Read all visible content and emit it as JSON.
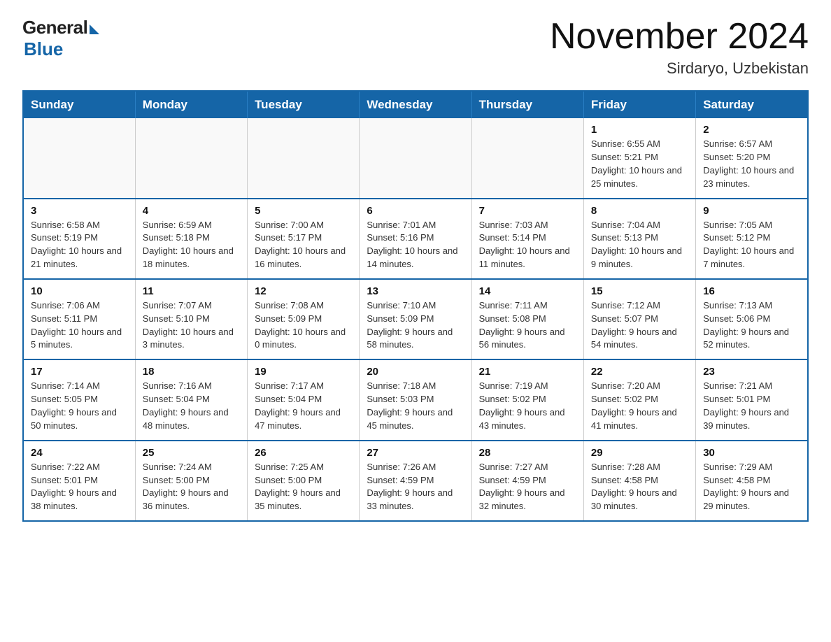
{
  "header": {
    "logo": {
      "general": "General",
      "blue": "Blue"
    },
    "title": "November 2024",
    "location": "Sirdaryo, Uzbekistan"
  },
  "calendar": {
    "days_of_week": [
      "Sunday",
      "Monday",
      "Tuesday",
      "Wednesday",
      "Thursday",
      "Friday",
      "Saturday"
    ],
    "weeks": [
      [
        {
          "day": "",
          "info": ""
        },
        {
          "day": "",
          "info": ""
        },
        {
          "day": "",
          "info": ""
        },
        {
          "day": "",
          "info": ""
        },
        {
          "day": "",
          "info": ""
        },
        {
          "day": "1",
          "info": "Sunrise: 6:55 AM\nSunset: 5:21 PM\nDaylight: 10 hours and 25 minutes."
        },
        {
          "day": "2",
          "info": "Sunrise: 6:57 AM\nSunset: 5:20 PM\nDaylight: 10 hours and 23 minutes."
        }
      ],
      [
        {
          "day": "3",
          "info": "Sunrise: 6:58 AM\nSunset: 5:19 PM\nDaylight: 10 hours and 21 minutes."
        },
        {
          "day": "4",
          "info": "Sunrise: 6:59 AM\nSunset: 5:18 PM\nDaylight: 10 hours and 18 minutes."
        },
        {
          "day": "5",
          "info": "Sunrise: 7:00 AM\nSunset: 5:17 PM\nDaylight: 10 hours and 16 minutes."
        },
        {
          "day": "6",
          "info": "Sunrise: 7:01 AM\nSunset: 5:16 PM\nDaylight: 10 hours and 14 minutes."
        },
        {
          "day": "7",
          "info": "Sunrise: 7:03 AM\nSunset: 5:14 PM\nDaylight: 10 hours and 11 minutes."
        },
        {
          "day": "8",
          "info": "Sunrise: 7:04 AM\nSunset: 5:13 PM\nDaylight: 10 hours and 9 minutes."
        },
        {
          "day": "9",
          "info": "Sunrise: 7:05 AM\nSunset: 5:12 PM\nDaylight: 10 hours and 7 minutes."
        }
      ],
      [
        {
          "day": "10",
          "info": "Sunrise: 7:06 AM\nSunset: 5:11 PM\nDaylight: 10 hours and 5 minutes."
        },
        {
          "day": "11",
          "info": "Sunrise: 7:07 AM\nSunset: 5:10 PM\nDaylight: 10 hours and 3 minutes."
        },
        {
          "day": "12",
          "info": "Sunrise: 7:08 AM\nSunset: 5:09 PM\nDaylight: 10 hours and 0 minutes."
        },
        {
          "day": "13",
          "info": "Sunrise: 7:10 AM\nSunset: 5:09 PM\nDaylight: 9 hours and 58 minutes."
        },
        {
          "day": "14",
          "info": "Sunrise: 7:11 AM\nSunset: 5:08 PM\nDaylight: 9 hours and 56 minutes."
        },
        {
          "day": "15",
          "info": "Sunrise: 7:12 AM\nSunset: 5:07 PM\nDaylight: 9 hours and 54 minutes."
        },
        {
          "day": "16",
          "info": "Sunrise: 7:13 AM\nSunset: 5:06 PM\nDaylight: 9 hours and 52 minutes."
        }
      ],
      [
        {
          "day": "17",
          "info": "Sunrise: 7:14 AM\nSunset: 5:05 PM\nDaylight: 9 hours and 50 minutes."
        },
        {
          "day": "18",
          "info": "Sunrise: 7:16 AM\nSunset: 5:04 PM\nDaylight: 9 hours and 48 minutes."
        },
        {
          "day": "19",
          "info": "Sunrise: 7:17 AM\nSunset: 5:04 PM\nDaylight: 9 hours and 47 minutes."
        },
        {
          "day": "20",
          "info": "Sunrise: 7:18 AM\nSunset: 5:03 PM\nDaylight: 9 hours and 45 minutes."
        },
        {
          "day": "21",
          "info": "Sunrise: 7:19 AM\nSunset: 5:02 PM\nDaylight: 9 hours and 43 minutes."
        },
        {
          "day": "22",
          "info": "Sunrise: 7:20 AM\nSunset: 5:02 PM\nDaylight: 9 hours and 41 minutes."
        },
        {
          "day": "23",
          "info": "Sunrise: 7:21 AM\nSunset: 5:01 PM\nDaylight: 9 hours and 39 minutes."
        }
      ],
      [
        {
          "day": "24",
          "info": "Sunrise: 7:22 AM\nSunset: 5:01 PM\nDaylight: 9 hours and 38 minutes."
        },
        {
          "day": "25",
          "info": "Sunrise: 7:24 AM\nSunset: 5:00 PM\nDaylight: 9 hours and 36 minutes."
        },
        {
          "day": "26",
          "info": "Sunrise: 7:25 AM\nSunset: 5:00 PM\nDaylight: 9 hours and 35 minutes."
        },
        {
          "day": "27",
          "info": "Sunrise: 7:26 AM\nSunset: 4:59 PM\nDaylight: 9 hours and 33 minutes."
        },
        {
          "day": "28",
          "info": "Sunrise: 7:27 AM\nSunset: 4:59 PM\nDaylight: 9 hours and 32 minutes."
        },
        {
          "day": "29",
          "info": "Sunrise: 7:28 AM\nSunset: 4:58 PM\nDaylight: 9 hours and 30 minutes."
        },
        {
          "day": "30",
          "info": "Sunrise: 7:29 AM\nSunset: 4:58 PM\nDaylight: 9 hours and 29 minutes."
        }
      ]
    ]
  }
}
